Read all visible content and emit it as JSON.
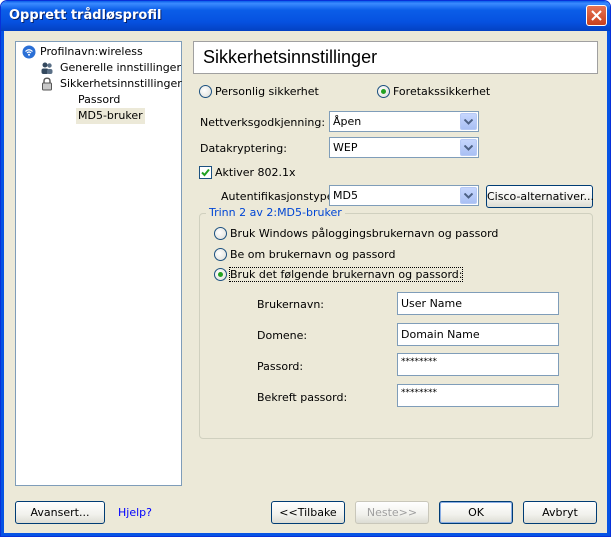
{
  "window": {
    "title": "Opprett trådløsprofil"
  },
  "tree": {
    "root": "Profilnavn:wireless",
    "items": [
      {
        "label": "Generelle innstillinger",
        "icon": "people-icon"
      },
      {
        "label": "Sikkerhetsinnstillinger",
        "icon": "lock-icon"
      },
      {
        "label": "Passord"
      },
      {
        "label": "MD5-bruker",
        "selected": true
      }
    ]
  },
  "header": {
    "title": "Sikkerhetsinnstillinger"
  },
  "security_mode": {
    "personal": "Personlig sikkerhet",
    "enterprise": "Foretakssikkerhet",
    "selected": "enterprise"
  },
  "fields": {
    "network_auth": {
      "label": "Nettverksgodkjenning:",
      "value": "Åpen"
    },
    "data_encryption": {
      "label": "Datakryptering:",
      "value": "WEP"
    },
    "enable_8021x": {
      "label": "Aktiver 802.1x",
      "checked": true
    },
    "auth_type": {
      "label": "Autentifikasjonstype:",
      "value": "MD5"
    }
  },
  "cisco_button": "Cisco-alternativer...",
  "step_group": {
    "title": "Trinn 2 av 2:MD5-bruker",
    "options": [
      "Bruk Windows påloggingsbrukernavn og passord",
      "Be om brukernavn og passord",
      "Bruk det følgende brukernavn og passord:"
    ],
    "selected_index": 2
  },
  "credentials": {
    "username": {
      "label": "Brukernavn:",
      "value": "User Name"
    },
    "domain": {
      "label": "Domene:",
      "value": "Domain Name"
    },
    "password": {
      "label": "Passord:",
      "value": "********"
    },
    "confirm": {
      "label": "Bekreft passord:",
      "value": "********"
    }
  },
  "footer": {
    "advanced": "Avansert...",
    "help": "Hjelp?",
    "back": "<<Tilbake",
    "next": "Neste>>",
    "ok": "OK",
    "cancel": "Avbryt"
  },
  "colors": {
    "title_bar": "#0653e4",
    "dialog_bg": "#ece9d8",
    "radio_dot": "#21a121",
    "link": "#0000ff"
  }
}
